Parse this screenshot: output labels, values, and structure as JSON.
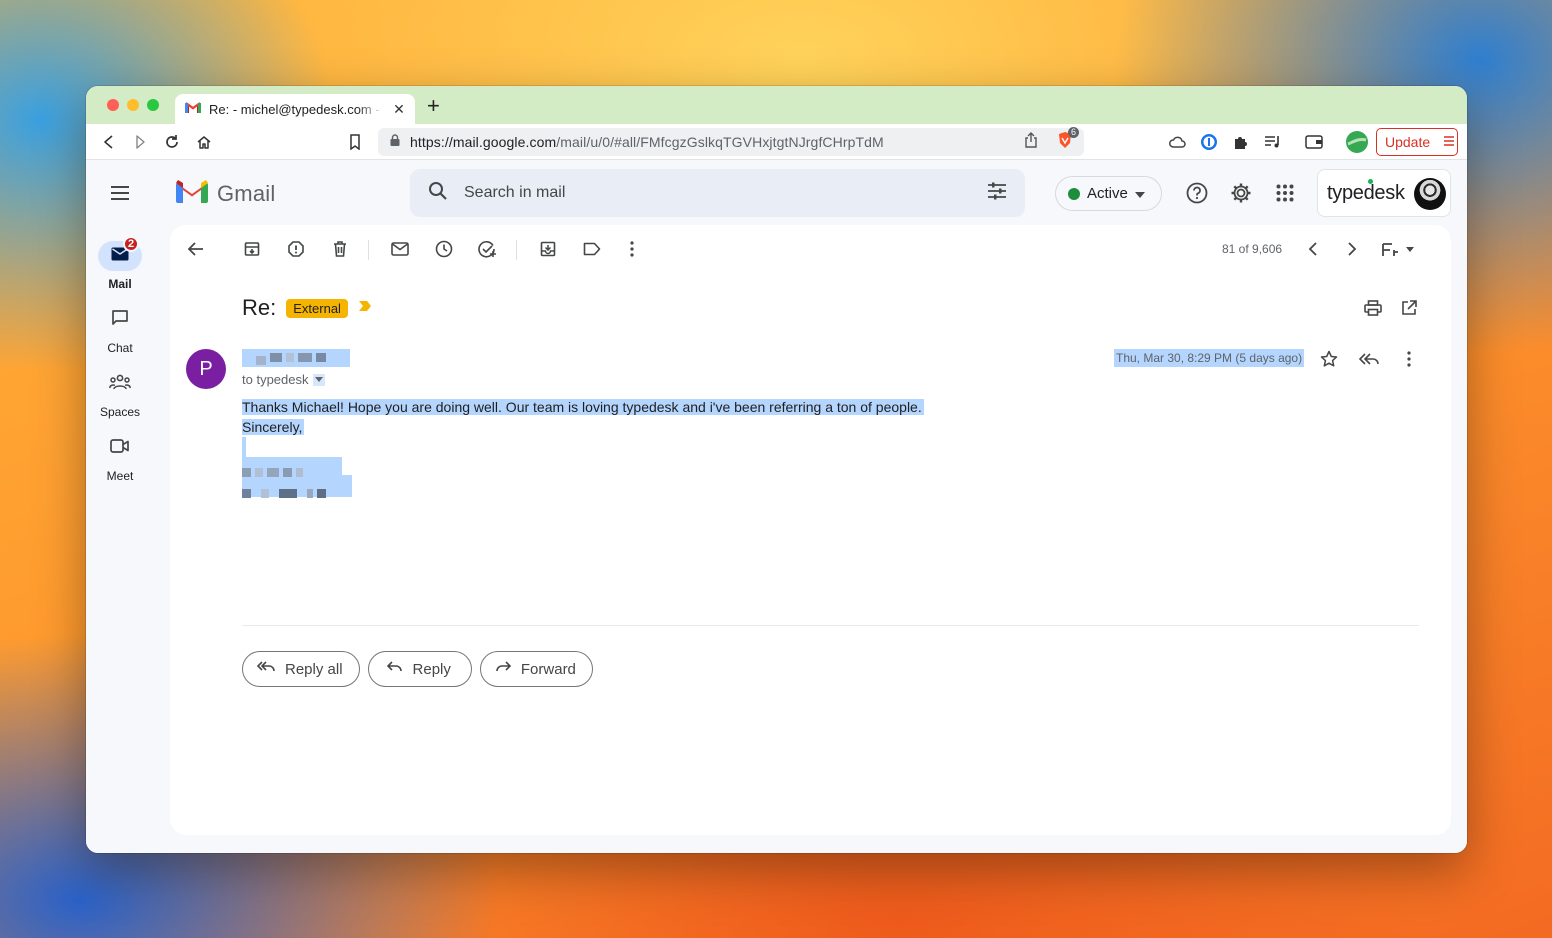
{
  "browser": {
    "tab_title": "Re: - michel@typedesk.com - typedesk",
    "new_tab_label": "+",
    "url_host": "https://mail.google.com",
    "url_path": "/mail/u/0/#all/FMfcgzGslkqTGVHxjtgtNJrgfCHrpTdM",
    "update_label": "Update",
    "brave_badge_count": "6"
  },
  "gmail": {
    "logo_text": "Gmail",
    "search_placeholder": "Search in mail",
    "status_label": "Active",
    "account_name": "typedesk",
    "rail": [
      {
        "label": "Mail",
        "badge": "2",
        "icon": "mail-icon"
      },
      {
        "label": "Chat",
        "icon": "chat-icon"
      },
      {
        "label": "Spaces",
        "icon": "spaces-icon"
      },
      {
        "label": "Meet",
        "icon": "meet-icon"
      }
    ],
    "pagination": "81 of 9,606",
    "colors": {
      "accent": "#0b57d0",
      "label": "#f4b400",
      "avatar": "#7b1fa2",
      "selection": "#b4d5fe"
    }
  },
  "email": {
    "subject": "Re:",
    "label": "External",
    "sender_initial": "P",
    "to_line": "to typedesk",
    "date": "Thu, Mar 30, 8:29 PM (5 days ago)",
    "body_line1": "Thanks Michael! Hope you are doing well. Our team is loving typedesk and i've been referring a ton of people.",
    "body_line2": "Sincerely,",
    "reply_all_label": "Reply all",
    "reply_label": "Reply",
    "forward_label": "Forward"
  }
}
